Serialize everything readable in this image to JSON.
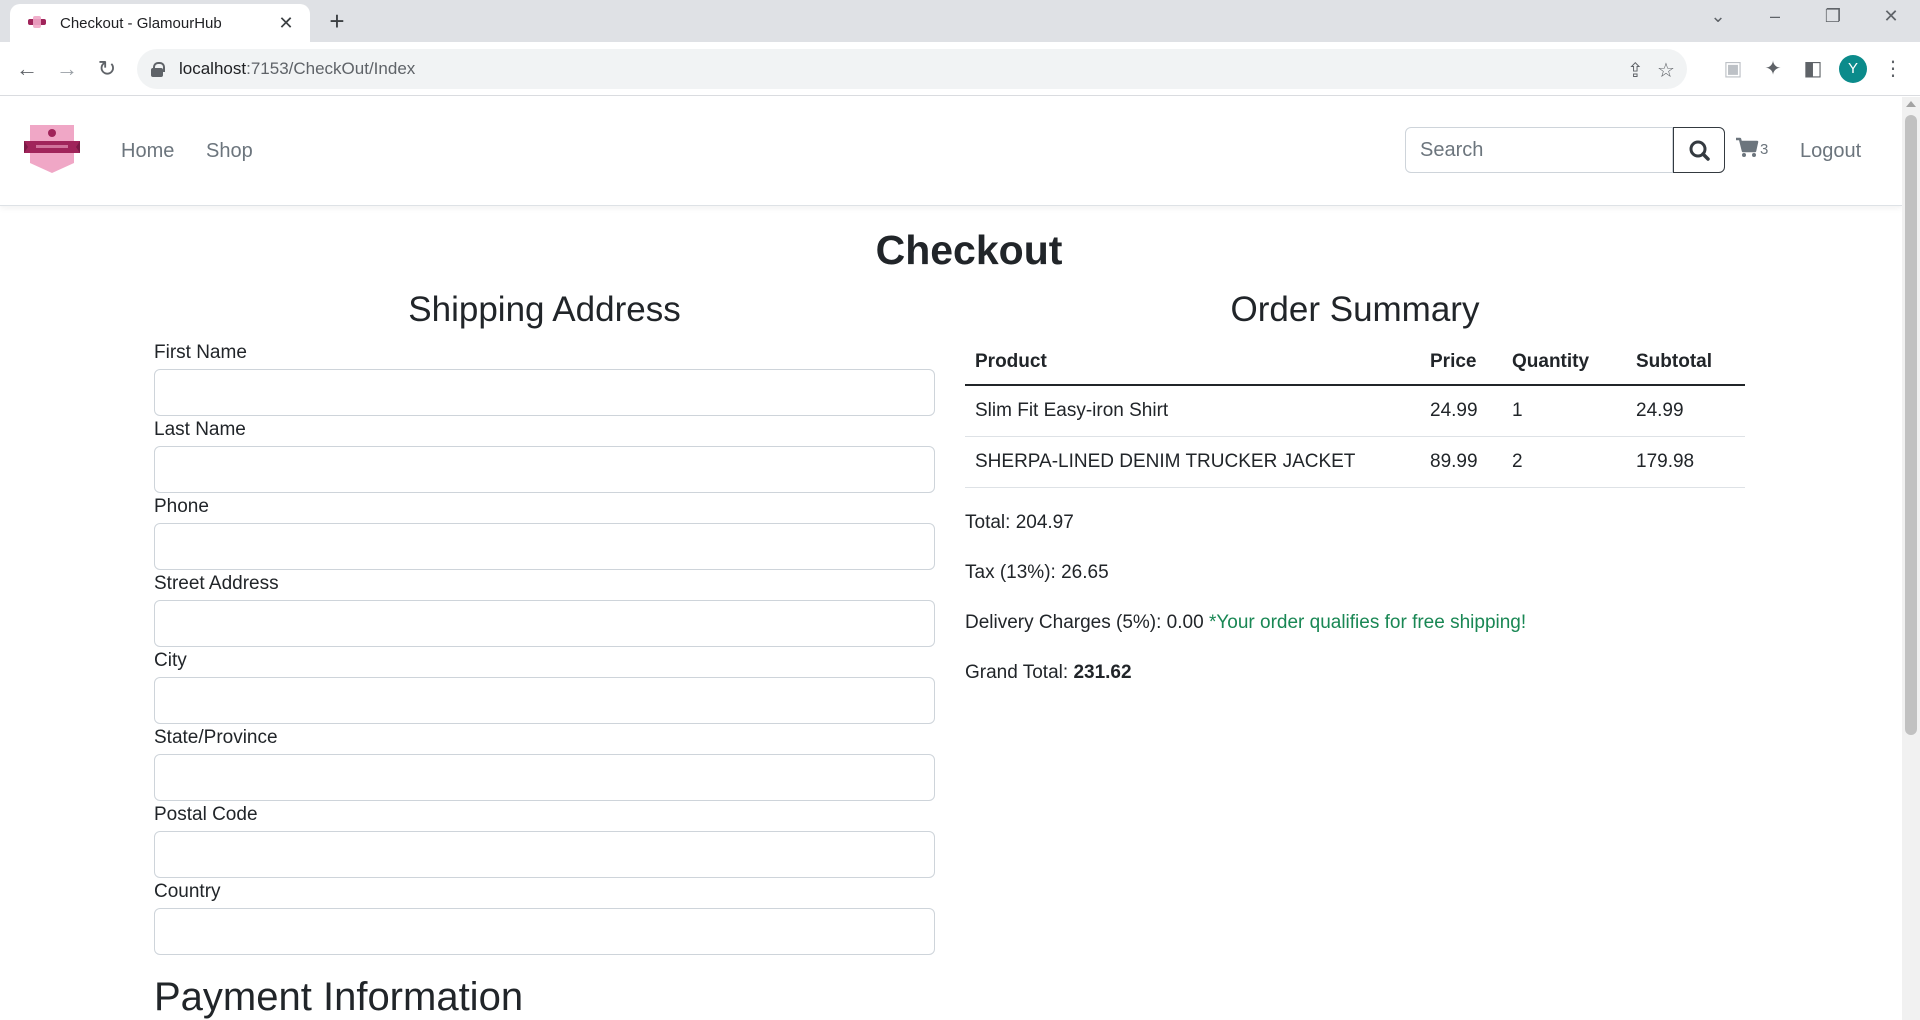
{
  "browser": {
    "tab_title": "Checkout - GlamourHub",
    "url_host": "localhost",
    "url_rest": ":7153/CheckOut/Index",
    "profile_initial": "Y"
  },
  "nav": {
    "links": [
      "Home",
      "Shop"
    ],
    "search_placeholder": "Search",
    "cart_count": "3",
    "logout_label": "Logout"
  },
  "page": {
    "title": "Checkout"
  },
  "shipping": {
    "title": "Shipping Address",
    "fields": [
      {
        "label": "First Name",
        "value": ""
      },
      {
        "label": "Last Name",
        "value": ""
      },
      {
        "label": "Phone",
        "value": ""
      },
      {
        "label": "Street Address",
        "value": ""
      },
      {
        "label": "City",
        "value": ""
      },
      {
        "label": "State/Province",
        "value": ""
      },
      {
        "label": "Postal Code",
        "value": ""
      },
      {
        "label": "Country",
        "value": ""
      }
    ]
  },
  "summary": {
    "title": "Order Summary",
    "columns": [
      "Product",
      "Price",
      "Quantity",
      "Subtotal"
    ],
    "rows": [
      {
        "product": "Slim Fit Easy-iron Shirt",
        "price": "24.99",
        "quantity": "1",
        "subtotal": "24.99"
      },
      {
        "product": "SHERPA-LINED DENIM TRUCKER JACKET",
        "price": "89.99",
        "quantity": "2",
        "subtotal": "179.98"
      }
    ],
    "total_label": "Total: ",
    "total_value": "204.97",
    "tax_label": "Tax (13%): ",
    "tax_value": "26.65",
    "delivery_label": "Delivery Charges (5%): ",
    "delivery_value": "0.00",
    "free_shipping_note": "*Your order qualifies for free shipping!",
    "grand_total_label": "Grand Total: ",
    "grand_total_value": "231.62"
  },
  "payment": {
    "title": "Payment Information"
  },
  "colors": {
    "brand": "#a0245a",
    "success": "#198754",
    "muted": "#6c757d"
  }
}
